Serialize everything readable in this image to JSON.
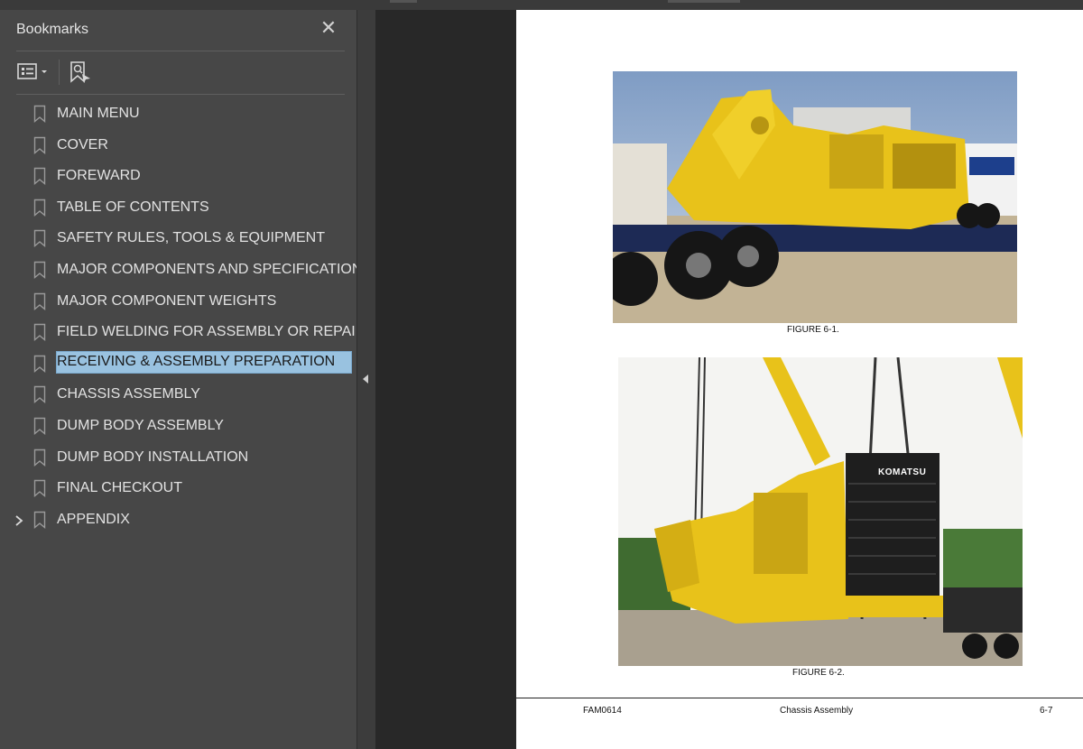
{
  "panel": {
    "title": "Bookmarks",
    "close_icon": "close-icon",
    "toolbar": {
      "options_icon": "bookmark-options-icon",
      "find_icon": "find-bookmark-icon"
    }
  },
  "bookmarks": [
    {
      "label": "MAIN MENU"
    },
    {
      "label": "COVER"
    },
    {
      "label": "FOREWARD"
    },
    {
      "label": "TABLE OF CONTENTS"
    },
    {
      "label": "SAFETY RULES, TOOLS & EQUIPMENT"
    },
    {
      "label": "MAJOR COMPONENTS AND SPECIFICATIONS"
    },
    {
      "label": "MAJOR COMPONENT WEIGHTS"
    },
    {
      "label": "FIELD WELDING FOR ASSEMBLY OR REPAIR"
    },
    {
      "label": "RECEIVING & ASSEMBLY PREPARATION",
      "selected": true
    },
    {
      "label": "CHASSIS ASSEMBLY"
    },
    {
      "label": "DUMP BODY ASSEMBLY"
    },
    {
      "label": "DUMP BODY INSTALLATION"
    },
    {
      "label": "FINAL CHECKOUT"
    },
    {
      "label": "APPENDIX",
      "expandable": true
    }
  ],
  "document": {
    "figure1_caption": "FIGURE 6-1.",
    "figure2_caption": "FIGURE 6-2.",
    "brand_text": "KOMATSU",
    "footer_left": "FAM0614",
    "footer_center": "Chassis Assembly",
    "footer_right": "6-7"
  },
  "colors": {
    "selection": "#99c2e0",
    "machine_yellow": "#e8c21a"
  }
}
